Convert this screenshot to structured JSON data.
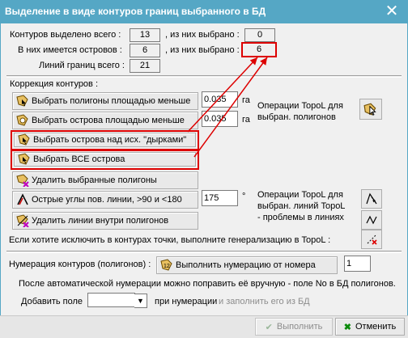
{
  "window": {
    "title": "Выделение в виде контуров границ выбранного в БД",
    "close_glyph": "✕"
  },
  "stats": {
    "contours_total_label": "Контуров выделено всего :",
    "contours_total_value": "13",
    "selected_label_1": ", из них выбрано :",
    "contours_selected_value": "0",
    "islands_label": "В них имеется островов :",
    "islands_value": "6",
    "selected_label_2": ", из них выбрано :",
    "islands_selected_value": "6",
    "lines_label": "Линий границ всего :",
    "lines_value": "21"
  },
  "correction": {
    "section_label": "Коррекция контуров :",
    "btn_polygons_area": "Выбрать полигоны площадью меньше",
    "area_polygons_value": "0.035",
    "unit_ha_1": "га",
    "btn_islands_area": "Выбрать острова площадью меньше",
    "area_islands_value": "0.035",
    "unit_ha_2": "га",
    "btn_islands_holes": "Выбрать острова над исх. \"дырками\"",
    "btn_all_islands": "Выбрать ВСЕ острова",
    "btn_delete_polygons": "Удалить выбранные полигоны",
    "btn_sharp_angles": "Острые углы пов. линии, >90 и <180",
    "angle_value": "175",
    "degree_symbol": "°",
    "btn_delete_lines": "Удалить линии внутри полигонов",
    "topol_ops_1": "Операции TopoL для выбран. полигонов",
    "topol_ops_2": "Операции TopoL для выбран. линий TopoL - проблемы в линиях",
    "generalize_note": "Если хотите исключить в контурах точки, выполните генерализацию в TopoL :"
  },
  "numbering": {
    "label": "Нумерация контуров (полигонов) :",
    "btn_run": "Выполнить нумерацию от номера",
    "start_value": "1",
    "note": "После автоматической нумерации можно  поправить её вручную - поле No в БД полигонов.",
    "add_field_label": "Добавить поле",
    "add_field_value": "",
    "on_numbering_label": "при нумерации",
    "fill_hint": "и заполнить его из БД"
  },
  "footer": {
    "run_label": "Выполнить",
    "cancel_label": "Отменить"
  },
  "colors": {
    "titlebar": "#55a7c5",
    "highlight": "#d00000",
    "face": "#f0f0f0"
  },
  "icons": {
    "polygon": "select-polygon-icon",
    "island": "select-island-icon",
    "delete": "delete-polygon-icon",
    "angle": "angle-icon",
    "lines": "delete-lines-icon",
    "topol_cursor": "cursor-icon",
    "topol_lines": "line-tool-icon",
    "generalize": "generalize-icon",
    "numbering": "numbering-icon",
    "check": "check-icon",
    "cancel_x": "cross-icon"
  }
}
